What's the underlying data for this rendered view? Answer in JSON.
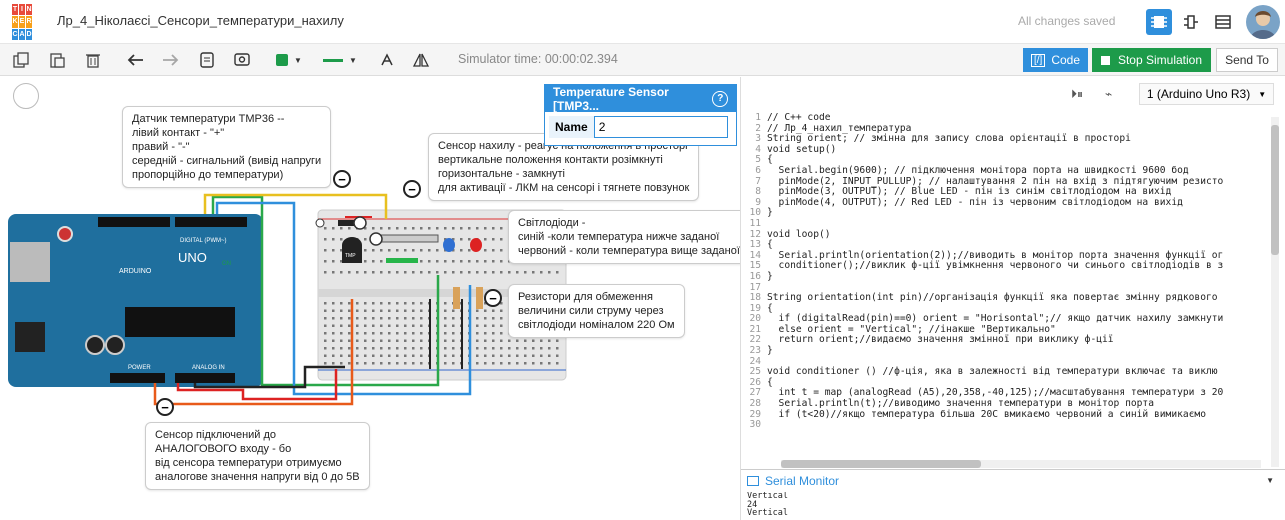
{
  "app": {
    "logo_letters": [
      "T",
      "I",
      "N",
      "K",
      "E",
      "R",
      "C",
      "A",
      "D"
    ],
    "title": "Лр_4_Ніколаєсі_Сенсори_температури_нахилу",
    "save_status": "All changes saved"
  },
  "toolbar": {
    "simulator_time": "Simulator time: 00:00:02.394",
    "code_label": "Code",
    "stop_label": "Stop Simulation",
    "send_label": "Send To"
  },
  "inspector": {
    "title": "Temperature Sensor [TMP3...",
    "name_label": "Name",
    "name_value": "2"
  },
  "notes": {
    "tmp36": "Датчик температури TMP36 --\nлівий контакт - \"+\"\nправий - \"-\"\nсередній - сигнальний (вивід напруги\nпропорційно до температури)",
    "tilt": "Сенсор нахилу - реагує на положення в просторі\nвертикальне положення контакти розімкнуті\nгоризонтальне - замкнуті\nдля активації - ЛКМ на сенсорі і тягнете повзунок",
    "leds": "Світлодіоди -\nсиній -коли температура нижче заданої\nчервоний - коли температура вище заданої",
    "resistors": "Резистори для обмеження\nвеличини сили струму через\nсвітлодіоди номіналом 220 Ом",
    "analog": "Сенсор підключений до\nАНАЛОГОВОГО входу - бо\nвід сенсора температури отримуємо\nаналогове значення напруги від 0 до 5В"
  },
  "code_panel": {
    "device": "1 (Arduino Uno R3)",
    "lines": [
      "// C++ code",
      "// Лр_4_нахил_температура",
      "String orient; // змінна для запису слова орієнтації в просторі",
      "void setup()",
      "{",
      "  Serial.begin(9600); // підключення монітора порта на швидкості 9600 бод",
      "  pinMode(2, INPUT_PULLUP); // налаштування 2 пін на вхід з підтягуючим резисто",
      "  pinMode(3, OUTPUT); // Blue LED - пін із синім світлодіодом на вихід",
      "  pinMode(4, OUTPUT); // Red LED - пін із червоним світлодіодом на вихід",
      "}",
      "",
      "void loop()",
      "{",
      "  Serial.println(orientation(2));//виводить в монітор порта значення функції ог",
      "  conditioner();//виклик ф-ції увімкнення червоного чи синього світлодіодів в з",
      "}",
      "",
      "String orientation(int pin)//організація функції яка повертає змінну рядкового",
      "{",
      "  if (digitalRead(pin)==0) orient = \"Horisontal\";// якщо датчик нахилу замкнути",
      "  else orient = \"Vertical\"; //інакше \"Вертикально\"",
      "  return orient;//видаємо значення змінної при виклику ф-ції",
      "}",
      "",
      "void conditioner () //ф-ція, яка в залежності від температури включає та виклю",
      "{",
      "  int t = map (analogRead (A5),20,358,-40,125);//масштабування температури з 20",
      "  Serial.println(t);//виводимо значення температури в монітор порта",
      "  if (t<20)//якщо температура більша 20С вмикаємо червоний а синій вимикаємо",
      "  "
    ],
    "serial_label": "Serial Monitor",
    "serial_output": [
      "Vertical",
      "24",
      "Vertical"
    ]
  },
  "board": {
    "uno_text": "UNO",
    "arduino_text": "ARDUINO",
    "digital_label": "DIGITAL (PWM~)",
    "power_label": "POWER",
    "analog_label": "ANALOG IN",
    "tmp_label": "TMP",
    "on_label": "ON"
  },
  "colors": {
    "accent": "#2f8fdc",
    "stop": "#1d9b4a",
    "arduino": "#1f6f9e"
  }
}
